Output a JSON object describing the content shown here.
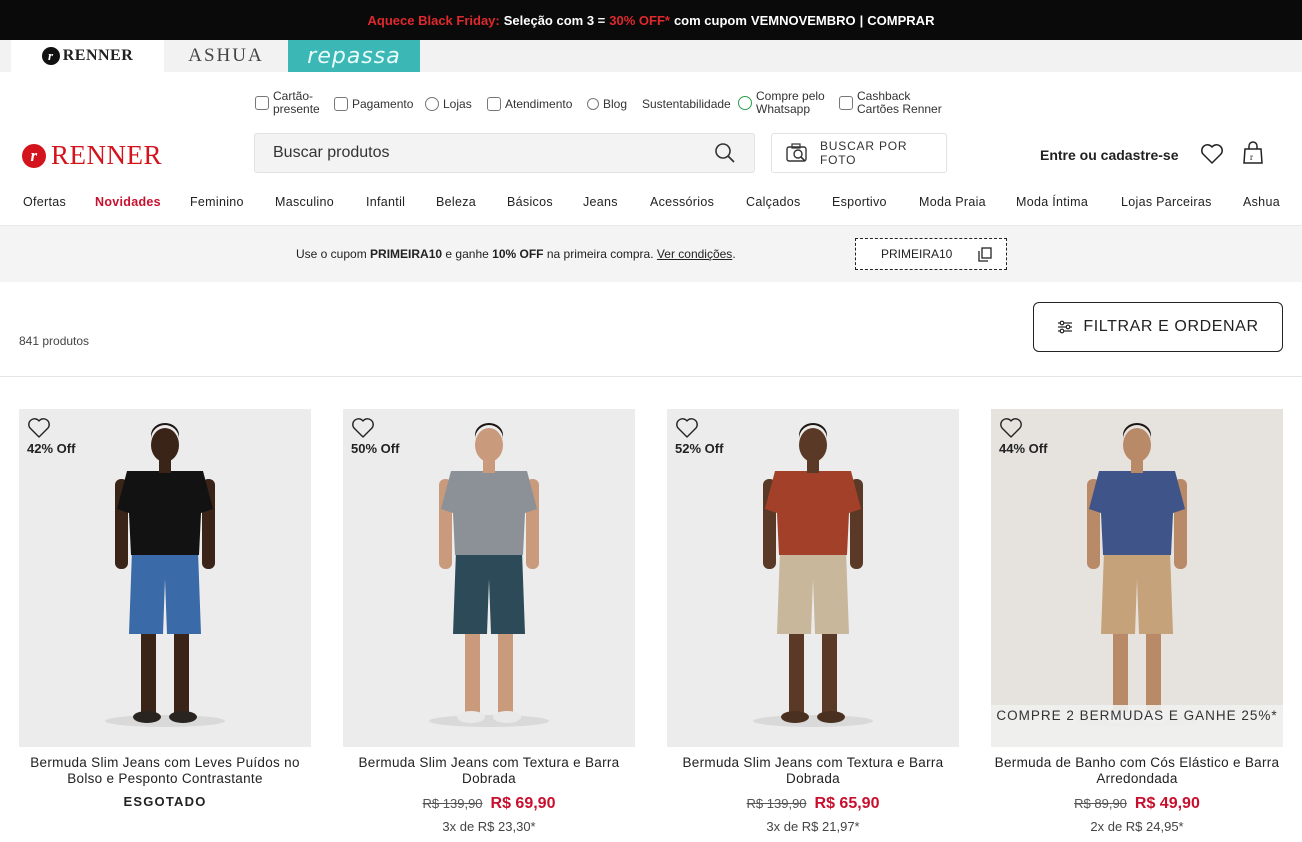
{
  "promo": {
    "highlight": "Aquece Black Friday:",
    "text1": "Seleção com 3 =",
    "discount": "30% OFF*",
    "text2": "com cupom",
    "code": "VEMNOVEMBRO",
    "separator": "|",
    "cta": "COMPRAR"
  },
  "brand_tabs": {
    "renner": "RENNER",
    "ashua": "ASHUA",
    "repassa": "repassa"
  },
  "utility": {
    "cartao_1": "Cartão-",
    "cartao_2": "presente",
    "pagamento": "Pagamento",
    "lojas": "Lojas",
    "atendimento": "Atendimento",
    "blog": "Blog",
    "sustentabilidade": "Sustentabilidade",
    "whatsapp_1": "Compre pelo",
    "whatsapp_2": "Whatsapp",
    "cashback_1": "Cashback",
    "cashback_2": "Cartões Renner"
  },
  "header": {
    "logo": "RENNER",
    "search_placeholder": "Buscar produtos",
    "photo_search": "BUSCAR POR FOTO",
    "login": "Entre ou cadastre-se"
  },
  "nav": {
    "ofertas": "Ofertas",
    "novidades": "Novidades",
    "feminino": "Feminino",
    "masculino": "Masculino",
    "infantil": "Infantil",
    "beleza": "Beleza",
    "basicos": "Básicos",
    "jeans": "Jeans",
    "acessorios": "Acessórios",
    "calcados": "Calçados",
    "esportivo": "Esportivo",
    "moda_praia": "Moda Praia",
    "moda_intima": "Moda Íntima",
    "lojas_parceiras": "Lojas Parceiras",
    "ashua": "Ashua"
  },
  "coupon": {
    "text1": "Use o cupom",
    "code": "PRIMEIRA10",
    "text2": "e ganhe",
    "discount": "10% OFF",
    "text3": "na primeira compra.",
    "link": "Ver condições",
    "dot": "."
  },
  "results": {
    "count": "841 produtos",
    "filter": "FILTRAR E ORDENAR"
  },
  "products": [
    {
      "off": "42% Off",
      "name": "Bermuda Slim Jeans com Leves Puídos no Bolso e Pesponto Contrastante",
      "status": "ESGOTADO",
      "shirt": "#121212",
      "shorts": "#3b6aa8",
      "skin": "#3a2417",
      "shoes": "#2a2420"
    },
    {
      "off": "50% Off",
      "name": "Bermuda Slim Jeans com Textura e Barra Dobrada",
      "old_price": "R$ 139,90",
      "new_price": "R$ 69,90",
      "installments": "3x de R$ 23,30*",
      "shirt": "#8c9097",
      "shorts": "#2c4a58",
      "skin": "#c99a7c",
      "shoes": "#e9e9e9"
    },
    {
      "off": "52% Off",
      "name": "Bermuda Slim Jeans com Textura e Barra Dobrada",
      "old_price": "R$ 139,90",
      "new_price": "R$ 65,90",
      "installments": "3x de R$ 21,97*",
      "shirt": "#a3402a",
      "shorts": "#c9b79c",
      "skin": "#5a3a26",
      "shoes": "#4a3020"
    },
    {
      "off": "44% Off",
      "name": "Bermuda de Banho com Cós Elástico e Barra Arredondada",
      "overlay": "COMPRE 2 BERMUDAS E GANHE 25%*",
      "old_price": "R$ 89,90",
      "new_price": "R$ 49,90",
      "installments": "2x de R$ 24,95*",
      "shirt": "#3f5488",
      "shorts": "#c5a27a",
      "skin": "#b98a68",
      "shoes": "#f2f2f2"
    }
  ],
  "colors": {
    "accent_red": "#c8102e",
    "repassa_teal": "#3bb8b5",
    "promo_bg": "#0a0a0a"
  }
}
